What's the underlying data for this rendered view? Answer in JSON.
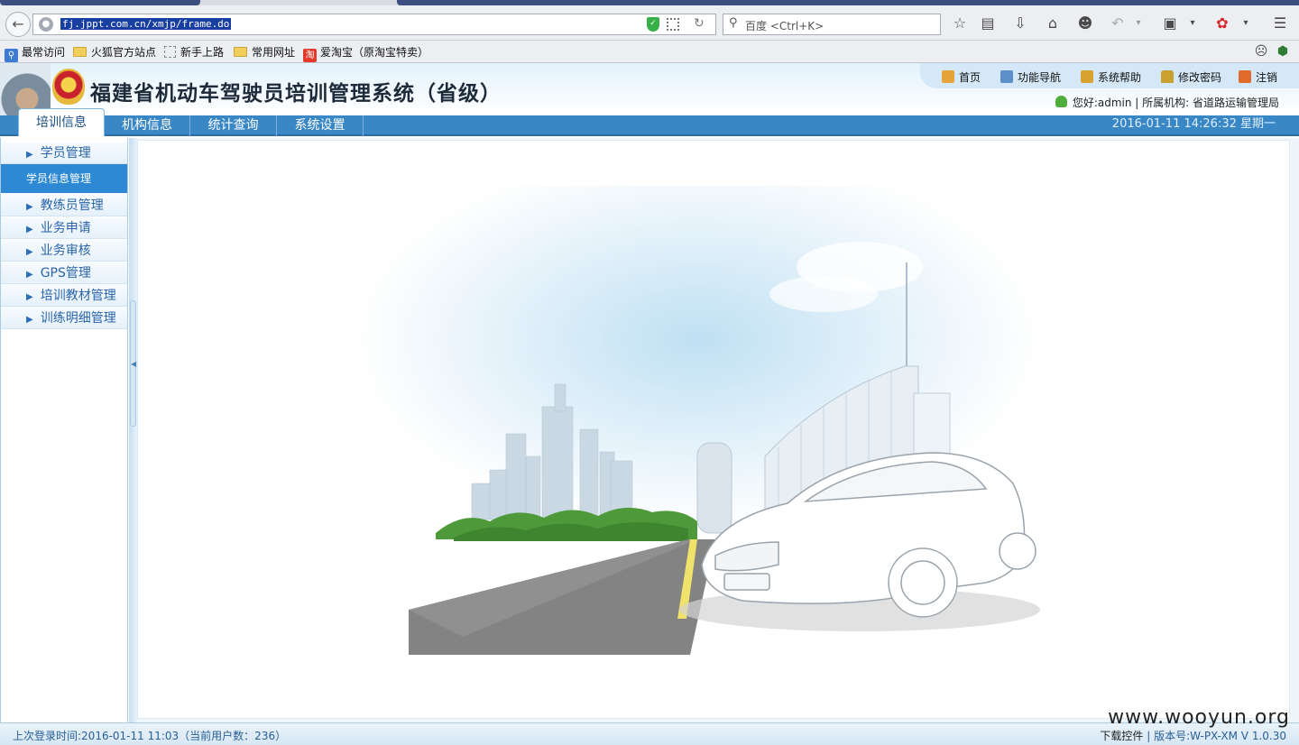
{
  "browser": {
    "url": "fj.jppt.com.cn/xmjp/frame.do",
    "search_placeholder": "百度 <Ctrl+K>",
    "bookmarks": [
      {
        "label": "最常访问",
        "icon": "most-visited-icon"
      },
      {
        "label": "火狐官方站点",
        "icon": "folder-icon"
      },
      {
        "label": "新手上路",
        "icon": "blank-page-icon"
      },
      {
        "label": "常用网址",
        "icon": "folder-icon"
      },
      {
        "label": "爱淘宝（原淘宝特卖）",
        "icon": "taobao-icon"
      }
    ]
  },
  "header": {
    "title": "福建省机动车驾驶员培训管理系统（省级）",
    "links": [
      {
        "label": "首页",
        "icon": "home-icon"
      },
      {
        "label": "功能导航",
        "icon": "grid-nav-icon"
      },
      {
        "label": "系统帮助",
        "icon": "help-book-icon"
      },
      {
        "label": "修改密码",
        "icon": "lock-icon"
      },
      {
        "label": "注销",
        "icon": "logout-icon"
      }
    ],
    "user_greeting": "您好:admin | 所属机构: 省道路运输管理局"
  },
  "nav": {
    "tabs": [
      {
        "label": "培训信息",
        "active": true
      },
      {
        "label": "机构信息",
        "active": false
      },
      {
        "label": "统计查询",
        "active": false
      },
      {
        "label": "系统设置",
        "active": false
      }
    ],
    "datetime": "2016-01-11 14:26:32 星期一"
  },
  "sidebar": {
    "items": [
      {
        "label": "学员管理",
        "expanded": true,
        "children": [
          "学员信息管理"
        ]
      },
      {
        "label": "教练员管理"
      },
      {
        "label": "业务申请"
      },
      {
        "label": "业务审核"
      },
      {
        "label": "GPS管理"
      },
      {
        "label": "培训教材管理"
      },
      {
        "label": "训练明细管理"
      }
    ]
  },
  "status": {
    "last_login": "上次登录时间:2016-01-11 11:03（当前用户数：236）",
    "download": "下载控件",
    "version": "版本号:W-PX-XM V 1.0.30"
  },
  "watermark": "www.wooyun.org",
  "colors": {
    "nav_blue": "#3a87c6",
    "sidebar_active": "#2e89d4",
    "link_blue": "#2a64a8"
  }
}
